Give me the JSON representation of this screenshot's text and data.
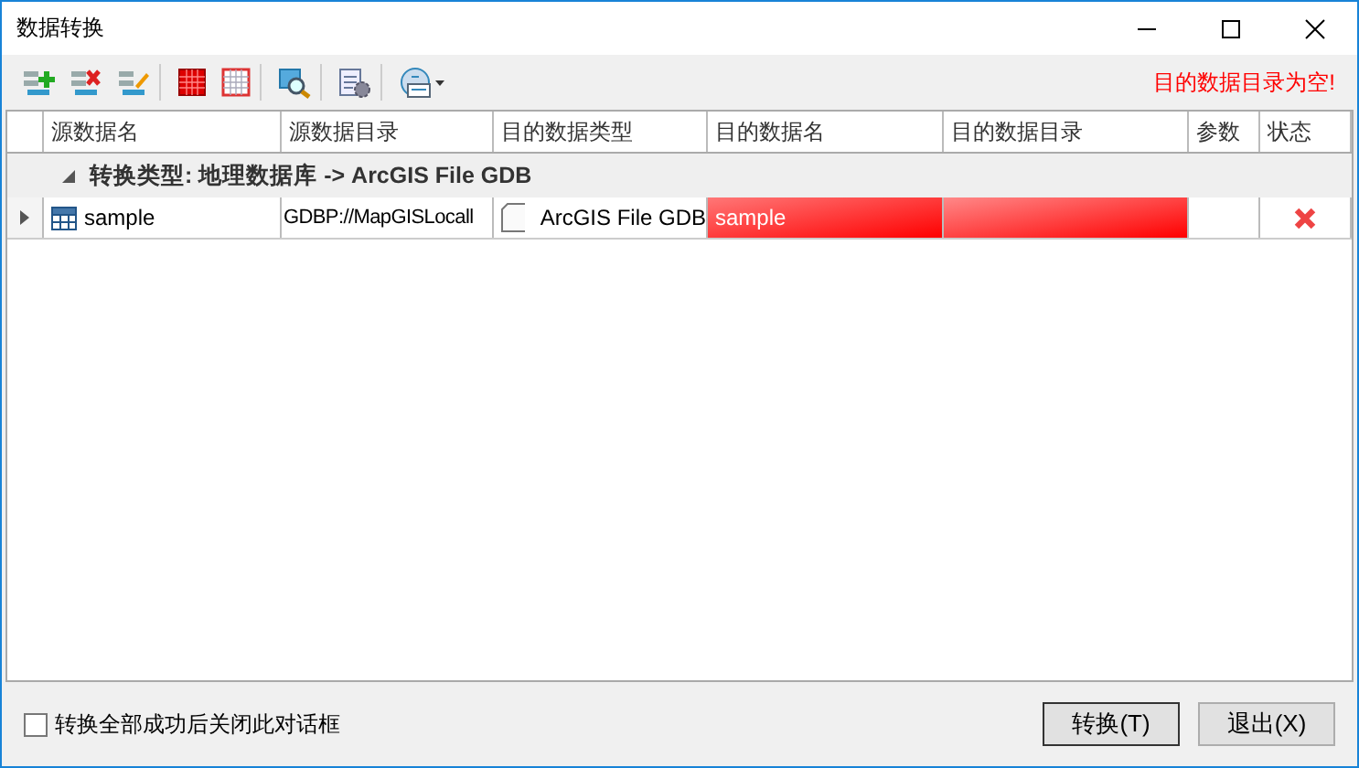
{
  "window": {
    "title": "数据转换"
  },
  "toolbar": {
    "groups": [
      [
        {
          "kind": "add"
        },
        {
          "kind": "delete"
        },
        {
          "kind": "edit"
        }
      ],
      [
        {
          "kind": "grid-fill"
        },
        {
          "kind": "grid-empty"
        }
      ],
      [
        {
          "kind": "find"
        }
      ],
      [
        {
          "kind": "settings"
        }
      ],
      [
        {
          "kind": "view-menu"
        }
      ]
    ],
    "message": "目的数据目录为空!"
  },
  "table": {
    "columns": [
      "源数据名",
      "源数据目录",
      "目的数据类型",
      "目的数据名",
      "目的数据目录",
      "参数",
      "状态"
    ],
    "groups": [
      {
        "label": "转换类型: 地理数据库 -> ArcGIS File GDB",
        "expanded": true,
        "rows": [
          {
            "selected": false,
            "source_name": "sample",
            "source_dir": "GDBP://MapGISLocall",
            "target_type": "ArcGIS File GDB",
            "target_name": {
              "text": "sample",
              "error": true
            },
            "target_dir": {
              "error": true
            },
            "status": {
              "kind": "error"
            }
          }
        ]
      }
    ]
  },
  "footer": {
    "close_on_success": {
      "label": "转换全部成功后关闭此对话框",
      "checked": false
    },
    "buttons": [
      {
        "label": "转换(T)",
        "default": true
      },
      {
        "label": "退出(X)",
        "default": false
      }
    ]
  }
}
